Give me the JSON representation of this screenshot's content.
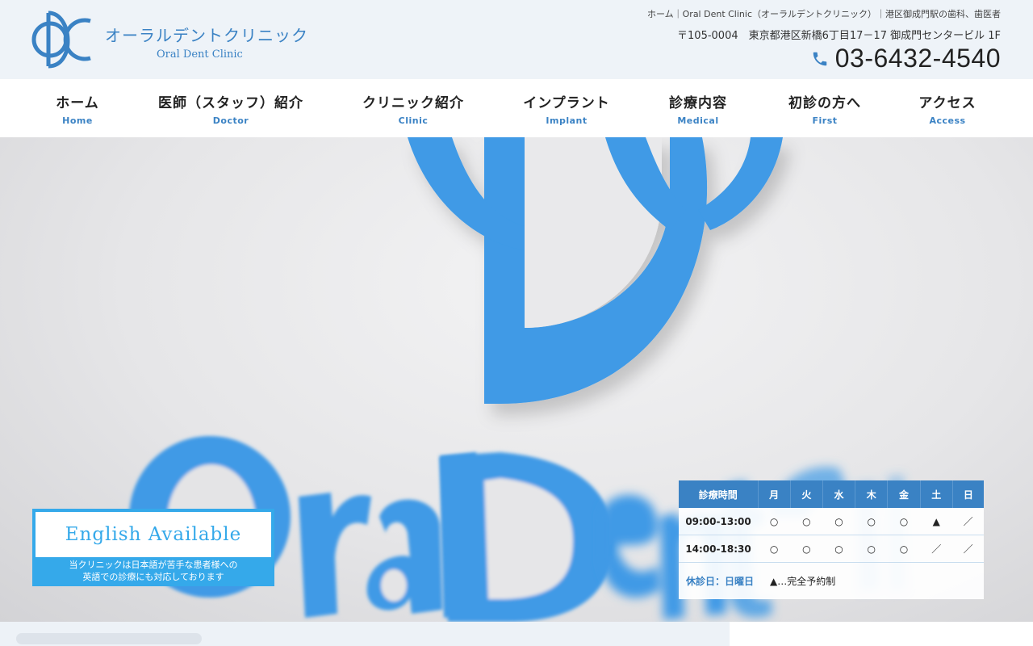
{
  "header": {
    "logo_jp": "オーラルデントクリニック",
    "logo_en": "Oral Dent Clinic",
    "breadcrumb": "ホーム｜Oral Dent Clinic（オーラルデントクリニック）｜港区御成門駅の歯科、歯医者",
    "address": "〒105-0004　東京都港区新橋6丁目17－17 御成門センタービル 1F",
    "phone": "03-6432-4540",
    "phone_icon": "phone-icon"
  },
  "nav": [
    {
      "jp": "ホーム",
      "en": "Home"
    },
    {
      "jp": "医師（スタッフ）紹介",
      "en": "Doctor"
    },
    {
      "jp": "クリニック紹介",
      "en": "Clinic"
    },
    {
      "jp": "インプラント",
      "en": "Implant"
    },
    {
      "jp": "診療内容",
      "en": "Medical"
    },
    {
      "jp": "初診の方へ",
      "en": "First"
    },
    {
      "jp": "アクセス",
      "en": "Access"
    }
  ],
  "hero": {
    "english_title": "English Available",
    "english_sub_1": "当クリニックは日本語が苦手な患者様への",
    "english_sub_2": "英語での診療にも対応しております"
  },
  "hours": {
    "header": [
      "診療時間",
      "月",
      "火",
      "水",
      "木",
      "金",
      "土",
      "日"
    ],
    "rows": [
      {
        "time": "09:00-13:00",
        "cells": [
          "○",
          "○",
          "○",
          "○",
          "○",
          "▲",
          "／"
        ]
      },
      {
        "time": "14:00-18:30",
        "cells": [
          "○",
          "○",
          "○",
          "○",
          "○",
          "／",
          "／"
        ]
      }
    ],
    "closed": "休診日：日曜日",
    "note": "▲…完全予約制"
  },
  "colors": {
    "brand": "#3a82c4",
    "accent": "#35a9ea",
    "sign_blue": "#3f9ae6"
  }
}
